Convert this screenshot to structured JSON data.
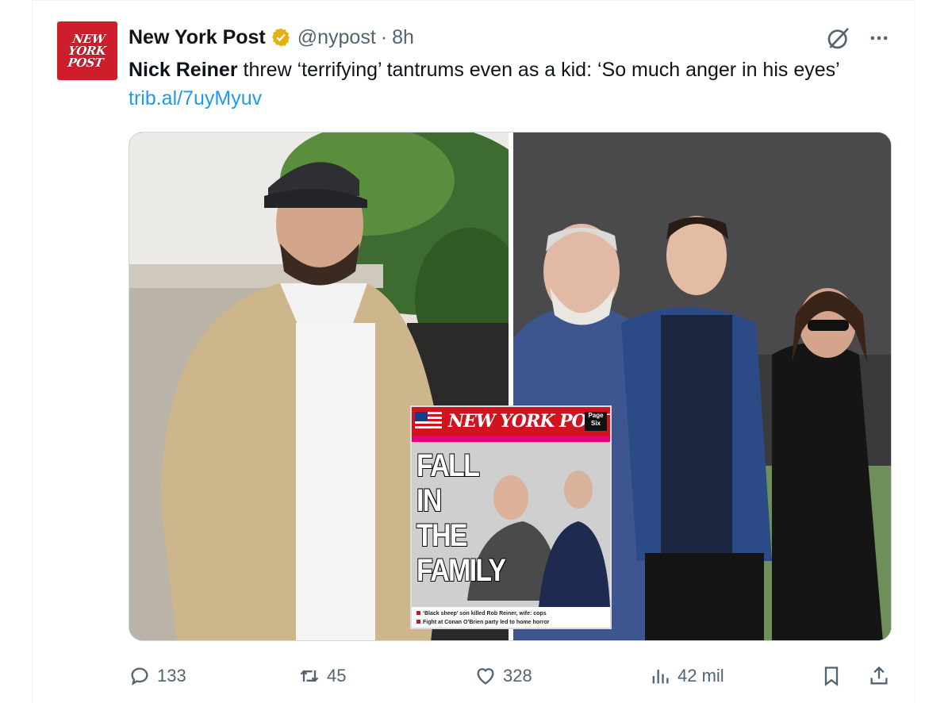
{
  "tweet": {
    "author_name": "New York Post",
    "handle": "@nypost",
    "separator": "·",
    "time": "8h",
    "avatar_text": [
      "NEW",
      "YORK",
      "POST"
    ],
    "text_bold": "Nick Reiner",
    "text_rest": " threw ‘terrifying’ tantrums even as a kid: ‘So much anger in his eyes’ ",
    "link": "trib.al/7uyMyuv"
  },
  "media": {
    "cover": {
      "masthead": "NEW YORK POST",
      "page_six": "Page Six",
      "headline": [
        "FALL",
        "IN",
        "THE",
        "FAMILY"
      ],
      "footer_lines": [
        "‘Black sheep’ son killed Rob Reiner, wife: cops",
        "Fight at Conan O’Brien party led to home horror"
      ]
    }
  },
  "actions": {
    "replies": "133",
    "retweets": "45",
    "likes": "328",
    "views": "42 mil"
  },
  "colors": {
    "accent": "#1d9bf0",
    "muted": "#536471",
    "verified": "#e8b00e",
    "brand_red": "#cf1e2b"
  },
  "icons": [
    "verified-badge-icon",
    "grok-icon",
    "more-icon",
    "reply-icon",
    "retweet-icon",
    "like-icon",
    "views-icon",
    "bookmark-icon",
    "share-icon"
  ]
}
